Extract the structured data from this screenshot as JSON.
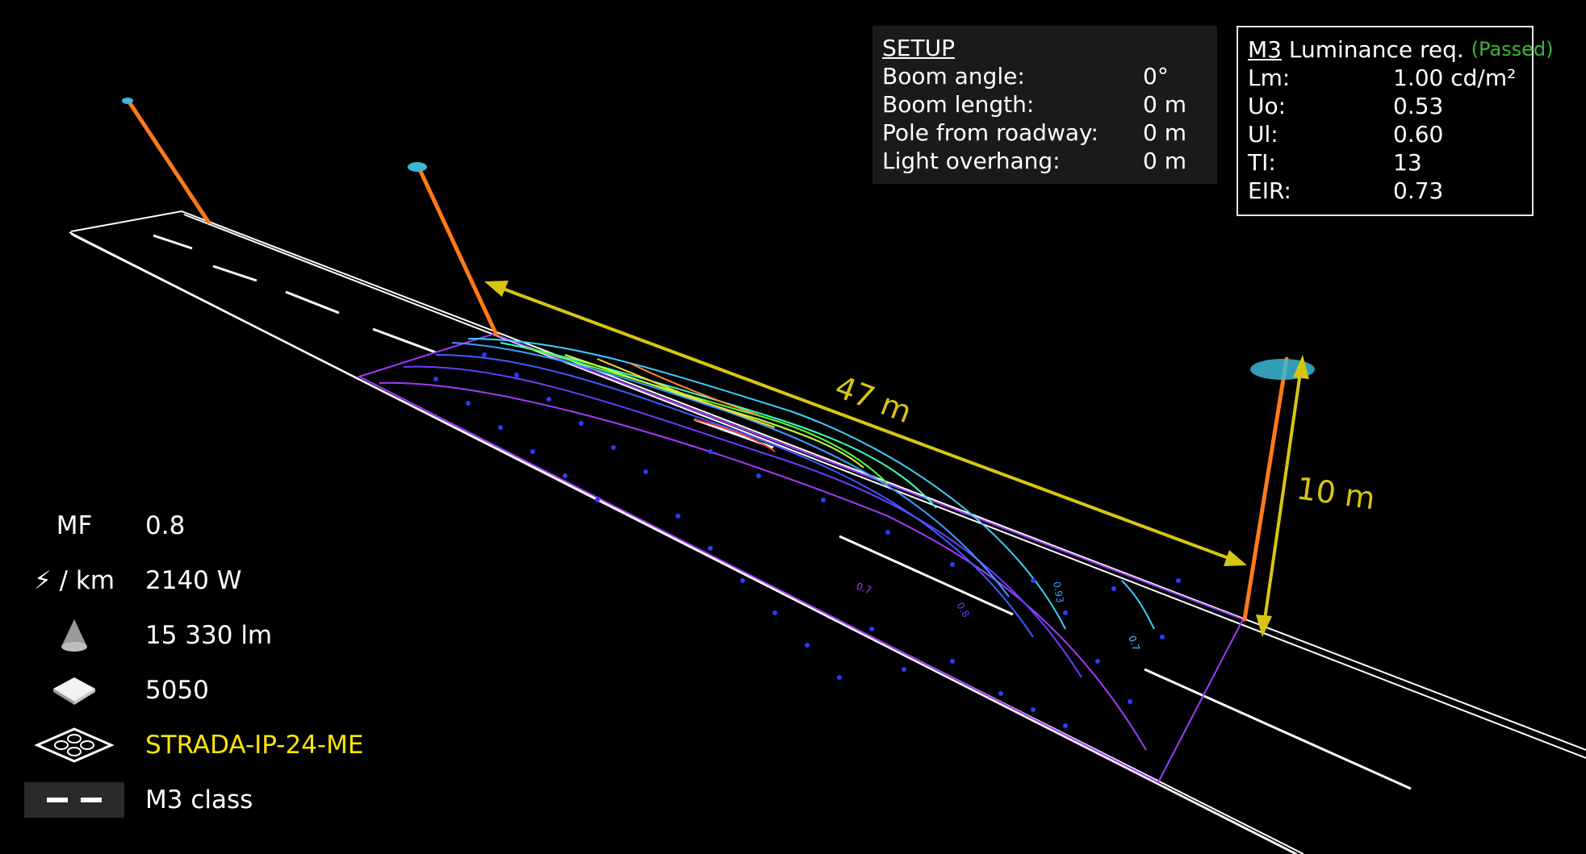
{
  "setup": {
    "title": "SETUP",
    "rows": [
      {
        "label": "Boom angle:",
        "value": "0°"
      },
      {
        "label": "Boom length:",
        "value": "0 m"
      },
      {
        "label": "Pole from roadway:",
        "value": "0 m"
      },
      {
        "label": "Light overhang:",
        "value": "0 m"
      }
    ]
  },
  "luminance": {
    "class_label": "M3",
    "title": "Luminance req.",
    "status": "(Passed)",
    "status_color": "#3fb536",
    "rows": [
      {
        "label": "Lm:",
        "value": "1.00 cd/m²"
      },
      {
        "label": "Uo:",
        "value": "0.53"
      },
      {
        "label": "Ul:",
        "value": "0.60"
      },
      {
        "label": "TI:",
        "value": "13"
      },
      {
        "label": "EIR:",
        "value": "0.73"
      }
    ]
  },
  "legend": {
    "mf_label": "MF",
    "mf_value": "0.8",
    "power_label": "/ km",
    "power_value": "2140 W",
    "flux_value": "15 330 lm",
    "cct_value": "5050",
    "luminaire_value": "STRADA-IP-24-ME",
    "class_value": "M3 class"
  },
  "dimensions": {
    "spacing": "47 m",
    "height": "10 m"
  },
  "contour_labels": {
    "a": "0.7",
    "b": "0.8",
    "c": "0.93",
    "d": "0.7"
  },
  "colors": {
    "pole": "#ff7a1a",
    "dimension": "#d6c614",
    "road_lines": "#ffffff",
    "luminaire": "#3bb8d6",
    "grid_points": "#2a3cff"
  }
}
